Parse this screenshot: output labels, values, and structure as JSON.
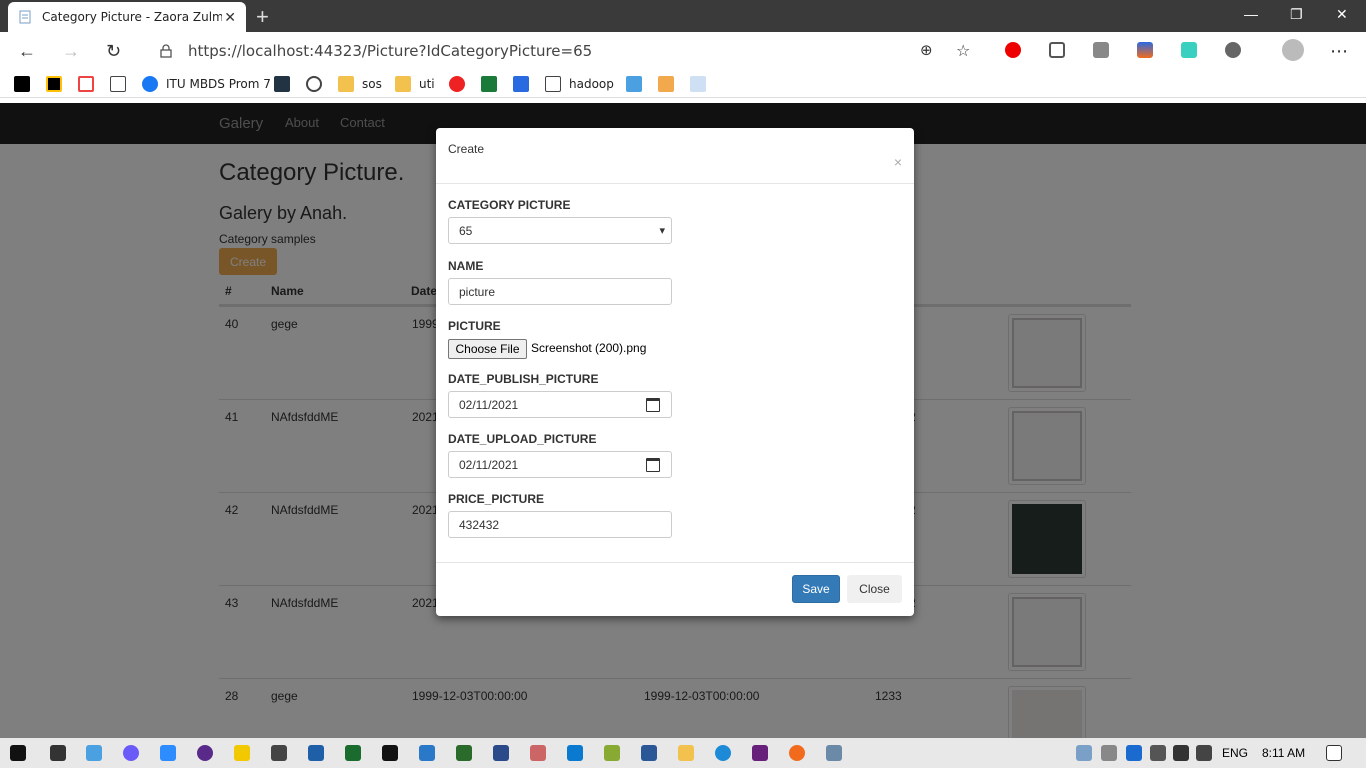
{
  "browser": {
    "tab_title": "Category Picture - Zaora Zulmiar",
    "url": "https://localhost:44323/Picture?IdCategoryPicture=65",
    "bookmarks": [
      "ITU MBDS Prom 7",
      "sos",
      "uti",
      "hadoop"
    ]
  },
  "site": {
    "brand": "Galery",
    "nav": [
      "About",
      "Contact"
    ],
    "heading": "Category Picture.",
    "subheading": "Galery by Anah.",
    "subtext": "Category samples",
    "create_label": "Create",
    "columns": [
      "#",
      "Name",
      "Date"
    ],
    "rows": [
      {
        "id": "40",
        "name": "gege",
        "date1": "1999",
        "date2": "",
        "price": ""
      },
      {
        "id": "41",
        "name": "NAfdsfddME",
        "date1": "2021",
        "date2": "",
        "price": "2"
      },
      {
        "id": "42",
        "name": "NAfdsfddME",
        "date1": "2021",
        "date2": "",
        "price": "2"
      },
      {
        "id": "43",
        "name": "NAfdsfddME",
        "date1": "2021",
        "date2": "",
        "price": "2"
      },
      {
        "id": "28",
        "name": "gege",
        "date1": "1999-12-03T00:00:00",
        "date2": "1999-12-03T00:00:00",
        "price": "1233"
      }
    ]
  },
  "modal": {
    "title": "Create",
    "close_x": "×",
    "category_label": "CATEGORY PICTURE",
    "category_value": "65",
    "name_label": "NAME",
    "name_value": "picture",
    "picture_label": "PICTURE",
    "file_button": "Choose File",
    "file_name": "Screenshot (200).png",
    "date_publish_label": "DATE_PUBLISH_PICTURE",
    "date_publish_value": "02/11/2021",
    "date_upload_label": "DATE_UPLOAD_PICTURE",
    "date_upload_value": "02/11/2021",
    "price_label": "PRICE_PICTURE",
    "price_value": "432432",
    "save_label": "Save",
    "close_label": "Close"
  },
  "taskbar": {
    "lang": "ENG",
    "time": "8:11 AM"
  },
  "colors": {
    "primary": "#337ab7",
    "warning": "#f0ad4e",
    "navbar": "#222222"
  }
}
